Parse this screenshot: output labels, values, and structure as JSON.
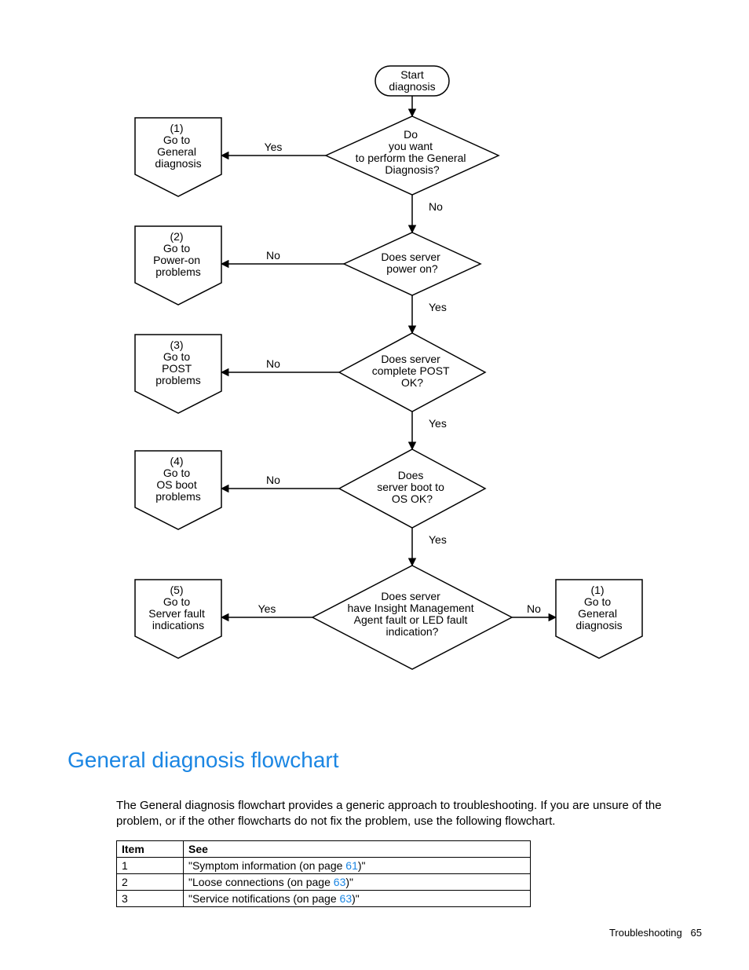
{
  "flowchart": {
    "start": "Start\ndiagnosis",
    "d1": "Do\nyou want\nto perform the General\nDiagnosis?",
    "d2": "Does server\npower on?",
    "d3": "Does server\ncomplete POST\nOK?",
    "d4": "Does\nserver boot to\nOS OK?",
    "d5": "Does server\nhave Insight Management\nAgent fault or LED fault\nindication?",
    "off1": "(1)\nGo to\nGeneral\ndiagnosis",
    "off2": "(2)\nGo to\nPower-on\nproblems",
    "off3": "(3)\nGo to\nPOST\nproblems",
    "off4": "(4)\nGo to\nOS boot\nproblems",
    "off5": "(5)\nGo to\nServer fault\nindications",
    "off1b": "(1)\nGo to\nGeneral\ndiagnosis",
    "labels": {
      "yes": "Yes",
      "no": "No"
    }
  },
  "heading": "General diagnosis flowchart",
  "paragraph": "The General diagnosis flowchart provides a generic approach to troubleshooting. If you are unsure of the problem, or if the other flowcharts do not fix the problem, use the following flowchart.",
  "table": {
    "headers": [
      "Item",
      "See"
    ],
    "rows": [
      {
        "item": "1",
        "see_pre": "\"Symptom information (on page ",
        "page": "61",
        "see_post": ")\""
      },
      {
        "item": "2",
        "see_pre": "\"Loose connections (on page ",
        "page": "63",
        "see_post": ")\""
      },
      {
        "item": "3",
        "see_pre": "\"Service notifications (on page ",
        "page": "63",
        "see_post": ")\""
      }
    ]
  },
  "footer": {
    "section": "Troubleshooting",
    "page": "65"
  }
}
